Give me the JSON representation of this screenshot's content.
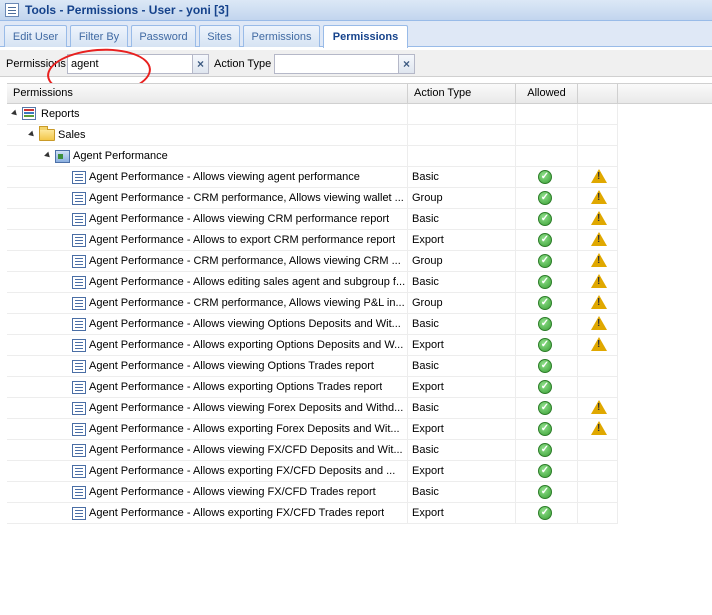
{
  "window": {
    "title": "Tools - Permissions - User - yoni [3]",
    "icon": "window-icon"
  },
  "tabs": [
    {
      "label": "Edit User"
    },
    {
      "label": "Filter By"
    },
    {
      "label": "Password"
    },
    {
      "label": "Sites"
    },
    {
      "label": "Permissions"
    },
    {
      "label": "Permissions",
      "active": true
    }
  ],
  "filter": {
    "permissions_label": "Permissions",
    "permissions_value": "agent",
    "action_type_label": "Action Type",
    "action_type_value": "",
    "clear_glyph": "×"
  },
  "annotation": {
    "color": "#e8201f",
    "shape": "freehand-circle"
  },
  "grid": {
    "columns": {
      "permissions": "Permissions",
      "action_type": "Action Type",
      "allowed": "Allowed"
    },
    "tree": {
      "root": "Reports",
      "group": "Sales",
      "module": "Agent Performance"
    },
    "rows": [
      {
        "name": "Agent Performance - Allows viewing agent performance",
        "type": "Basic",
        "allowed": true,
        "warning": true
      },
      {
        "name": "Agent Performance - CRM performance, Allows viewing wallet ...",
        "type": "Group",
        "allowed": true,
        "warning": true
      },
      {
        "name": "Agent Performance - Allows viewing CRM performance report",
        "type": "Basic",
        "allowed": true,
        "warning": true
      },
      {
        "name": "Agent Performance - Allows to export CRM performance report",
        "type": "Export",
        "allowed": true,
        "warning": true
      },
      {
        "name": "Agent Performance - CRM performance, Allows viewing CRM ...",
        "type": "Group",
        "allowed": true,
        "warning": true
      },
      {
        "name": "Agent Performance - Allows editing sales agent and subgroup f...",
        "type": "Basic",
        "allowed": true,
        "warning": true
      },
      {
        "name": "Agent Performance - CRM performance, Allows viewing P&L in...",
        "type": "Group",
        "allowed": true,
        "warning": true
      },
      {
        "name": "Agent Performance - Allows viewing Options Deposits and Wit...",
        "type": "Basic",
        "allowed": true,
        "warning": true
      },
      {
        "name": "Agent Performance - Allows exporting Options Deposits and W...",
        "type": "Export",
        "allowed": true,
        "warning": true
      },
      {
        "name": "Agent Performance - Allows viewing Options Trades report",
        "type": "Basic",
        "allowed": true,
        "warning": false
      },
      {
        "name": "Agent Performance - Allows exporting Options Trades report",
        "type": "Export",
        "allowed": true,
        "warning": false
      },
      {
        "name": "Agent Performance - Allows viewing Forex Deposits and Withd...",
        "type": "Basic",
        "allowed": true,
        "warning": true
      },
      {
        "name": "Agent Performance - Allows exporting Forex Deposits and Wit...",
        "type": "Export",
        "allowed": true,
        "warning": true
      },
      {
        "name": "Agent Performance - Allows viewing FX/CFD Deposits and Wit...",
        "type": "Basic",
        "allowed": true,
        "warning": false
      },
      {
        "name": "Agent Performance - Allows exporting FX/CFD Deposits and ...",
        "type": "Export",
        "allowed": true,
        "warning": false
      },
      {
        "name": "Agent Performance - Allows viewing FX/CFD Trades report",
        "type": "Basic",
        "allowed": true,
        "warning": false
      },
      {
        "name": "Agent Performance - Allows exporting FX/CFD Trades report",
        "type": "Export",
        "allowed": true,
        "warning": false
      }
    ]
  },
  "colors": {
    "title_text": "#15428b",
    "tab_border": "#99bbe8",
    "allowed_green": "#3a9f35",
    "warning_yellow": "#e0a800"
  }
}
